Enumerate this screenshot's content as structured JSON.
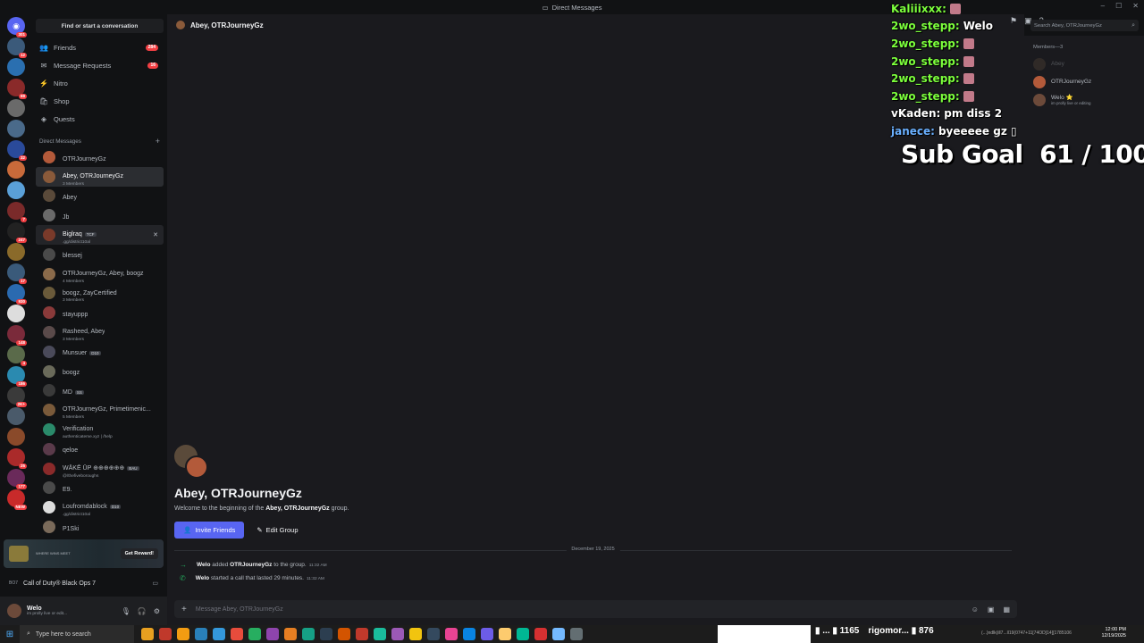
{
  "window": {
    "title": "Direct Messages"
  },
  "servers": [
    {
      "badge": "301",
      "color": "#5865f2",
      "home": true,
      "icon": "discord-icon"
    },
    {
      "badge": "12",
      "color": "#3b5a7a"
    },
    {
      "badge": "",
      "color": "#2a6fb0"
    },
    {
      "badge": "69",
      "color": "#8a2a2a"
    },
    {
      "badge": "",
      "color": "#6a6a6a"
    },
    {
      "badge": "",
      "color": "#4a6a8a"
    },
    {
      "badge": "32",
      "color": "#2a4a9a"
    },
    {
      "badge": "",
      "color": "#c86a3a"
    },
    {
      "badge": "",
      "color": "#5aa0d8"
    },
    {
      "badge": "7",
      "color": "#7a2a2a"
    },
    {
      "badge": "247",
      "color": "#222"
    },
    {
      "badge": "",
      "color": "#8a6a2a"
    },
    {
      "badge": "17",
      "color": "#3a5a7a"
    },
    {
      "badge": "930",
      "color": "#2a6ab0"
    },
    {
      "badge": "",
      "color": "#dddddd"
    },
    {
      "badge": "148",
      "color": "#7a2a3a"
    },
    {
      "badge": "4",
      "color": "#5a6a4a"
    },
    {
      "badge": "186",
      "color": "#2a8ab0"
    },
    {
      "badge": "2K+",
      "color": "#3a3a3a"
    },
    {
      "badge": "",
      "color": "#4a5a6a"
    },
    {
      "badge": "",
      "color": "#8a4a2a"
    },
    {
      "badge": "25",
      "color": "#aa2a2a"
    },
    {
      "badge": "177",
      "color": "#6a2a5a"
    },
    {
      "badge": "NEW",
      "color": "#c82a2a"
    }
  ],
  "sidebar": {
    "find_label": "Find or start a conversation",
    "nav": [
      {
        "label": "Friends",
        "badge": "284",
        "icon": "friends-icon"
      },
      {
        "label": "Message Requests",
        "badge": "16",
        "icon": "inbox-icon"
      },
      {
        "label": "Nitro",
        "badge": "",
        "icon": "nitro-icon"
      },
      {
        "label": "Shop",
        "badge": "",
        "icon": "shop-icon"
      },
      {
        "label": "Quests",
        "badge": "",
        "icon": "quests-icon"
      }
    ],
    "dm_header": "Direct Messages",
    "dms": [
      {
        "name": "OTRJourneyGz",
        "sub": "",
        "tag": "",
        "color": "#b35a3a",
        "state": ""
      },
      {
        "name": "Abey, OTRJourneyGz",
        "sub": "3 Members",
        "tag": "",
        "color": "#8a5a3a",
        "state": "active"
      },
      {
        "name": "Abey",
        "sub": "",
        "tag": "",
        "color": "#5a4a3a",
        "state": ""
      },
      {
        "name": "Jb",
        "sub": "",
        "tag": "",
        "color": "#6a6a6a",
        "state": ""
      },
      {
        "name": "Biglraq",
        "sub": ".gg/district10al",
        "tag": "TCF",
        "color": "#7a3a2a",
        "state": "hover"
      },
      {
        "name": "blessej",
        "sub": "",
        "tag": "",
        "color": "#4a4a4a",
        "state": ""
      },
      {
        "name": "OTRJourneyGz, Abey, boogz",
        "sub": "4 Members",
        "tag": "",
        "color": "#8a6a4a",
        "state": ""
      },
      {
        "name": "boogz, ZayCertified",
        "sub": "3 Members",
        "tag": "",
        "color": "#6a5a3a",
        "state": ""
      },
      {
        "name": "stayuppp",
        "sub": "",
        "tag": "",
        "color": "#8a3a3a",
        "state": ""
      },
      {
        "name": "Rasheed, Abey",
        "sub": "3 Members",
        "tag": "",
        "color": "#5a4a4a",
        "state": ""
      },
      {
        "name": "Munsuer",
        "sub": "",
        "tag": "D10",
        "color": "#4a4a5a",
        "state": ""
      },
      {
        "name": "boogz",
        "sub": "",
        "tag": "",
        "color": "#6a6a5a",
        "state": ""
      },
      {
        "name": "MD",
        "sub": "",
        "tag": "SS",
        "color": "#3a3a3a",
        "state": ""
      },
      {
        "name": "OTRJourneyGz, Primetimenic...",
        "sub": "5 Members",
        "tag": "",
        "color": "#7a5a3a",
        "state": ""
      },
      {
        "name": "Verification",
        "sub": "authenticateme.xyz | /help",
        "tag": "",
        "color": "#2a8a6a",
        "state": ""
      },
      {
        "name": "qeloe",
        "sub": "",
        "tag": "",
        "color": "#5a3a4a",
        "state": ""
      },
      {
        "name": "WĀKĒ ŪP ⊕⊕⊕⊕⊕⊕",
        "sub": "@/thefiveboroughs",
        "tag": "BAU",
        "color": "#8a2a2a",
        "state": ""
      },
      {
        "name": "E9.",
        "sub": "",
        "tag": "",
        "color": "#4a4a4a",
        "state": ""
      },
      {
        "name": "Loufromdablock",
        "sub": ".gg/district10al",
        "tag": "D10",
        "color": "#dddddd",
        "state": ""
      },
      {
        "name": "P1Ski",
        "sub": "",
        "tag": "",
        "color": "#7a6a5a",
        "state": ""
      }
    ],
    "promo": {
      "text": "WHERE WINS MEET",
      "button": "Get Reward!"
    },
    "activity": {
      "game": "Call of Duty® Black Ops 7",
      "prefix": "BO7"
    }
  },
  "user": {
    "name": "Welo",
    "status": "im prolly live or edit..."
  },
  "chat": {
    "header_title": "Abey, OTRJourneyGz",
    "welcome_title": "Abey, OTRJourneyGz",
    "welcome_prefix": "Welcome to the beginning of the ",
    "welcome_group": "Abey, OTRJourneyGz",
    "welcome_suffix": " group.",
    "invite_label": "Invite Friends",
    "edit_label": "Edit Group",
    "date_divider": "December 19, 2025",
    "messages": [
      {
        "actor": "Welo",
        "middle": " added ",
        "target": "OTRJourneyGz",
        "tail": " to the group.",
        "time": "11:32 AM",
        "icon": "join-arrow-icon"
      },
      {
        "actor": "Welo",
        "middle": " started a call that lasted 29 minutes.",
        "target": "",
        "tail": "",
        "time": "11:32 AM",
        "icon": "phone-icon"
      }
    ],
    "composer_placeholder": "Message Abey, OTRJourneyGz"
  },
  "search": {
    "placeholder": "Search Abey, OTRJourneyGz"
  },
  "members": {
    "header": "Members—3",
    "list": [
      {
        "name": "Abey",
        "status": "",
        "color": "#5a4a3a",
        "dim": true
      },
      {
        "name": "OTRJourneyGz",
        "status": "",
        "color": "#b35a3a",
        "dim": false
      },
      {
        "name": "Welo ⭐",
        "status": "im prolly live or editing",
        "color": "#6c4a3a",
        "dim": false
      }
    ]
  },
  "stream_chat": [
    {
      "user": "Kaliiixxx:",
      "msg": "",
      "user_color": "#7cff3c"
    },
    {
      "user": "2wo_stepp:",
      "msg": "Welo",
      "user_color": "#7cff3c"
    },
    {
      "user": "2wo_stepp:",
      "msg": "",
      "user_color": "#7cff3c"
    },
    {
      "user": "2wo_stepp:",
      "msg": "",
      "user_color": "#7cff3c"
    },
    {
      "user": "2wo_stepp:",
      "msg": "",
      "user_color": "#7cff3c"
    },
    {
      "user": "2wo_stepp:",
      "msg": "",
      "user_color": "#7cff3c"
    },
    {
      "user": "vKaden:",
      "msg": "pm diss 2",
      "user_color": "#ffffff"
    },
    {
      "user": "janece:",
      "msg": "byeeeee gz ▯",
      "user_color": "#6ab0ff"
    }
  ],
  "sub_goal": {
    "label": "Sub Goal",
    "current": "61",
    "sep": " / ",
    "target": "100"
  },
  "taskbar": {
    "search_placeholder": "Type here to search",
    "viewers_a": "▮ ... ▮ 1165",
    "viewers_b": "rigomor... ▮ 876",
    "time": "12:00 PM",
    "date": "12/19/2025",
    "tray_text": "(...)ndlk(ill7...ll19(0747+11[74OD]14][1785106"
  },
  "colors": {
    "accent": "#5865f2",
    "danger": "#f23f43",
    "online": "#23a55a",
    "bg": "#1a1a1e",
    "sidebar": "#111214"
  }
}
